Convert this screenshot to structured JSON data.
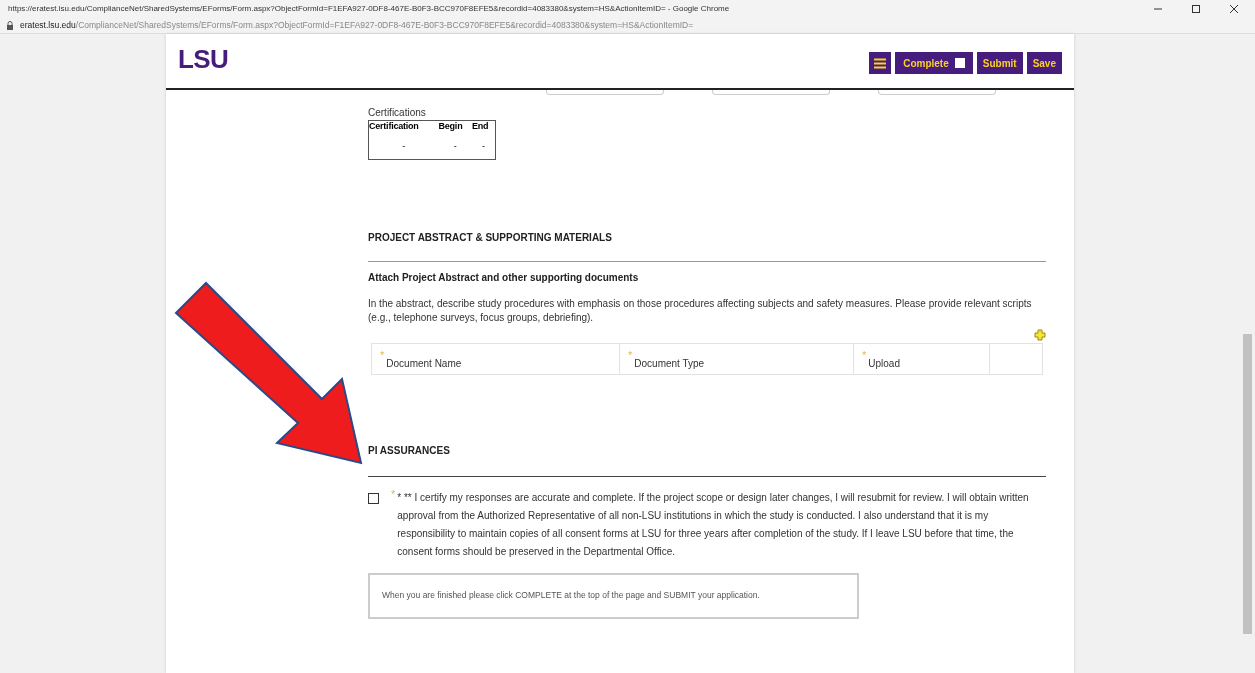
{
  "browser": {
    "title": "https://eratest.lsu.edu/ComplianceNet/SharedSystems/EForms/Form.aspx?ObjectFormId=F1EFA927-0DF8-467E-B0F3-BCC970F8EFE5&recordid=4083380&system=HS&ActionItemID= - Google Chrome",
    "url_domain": "eratest.lsu.edu",
    "url_path": "/ComplianceNet/SharedSystems/EForms/Form.aspx?ObjectFormId=F1EFA927-0DF8-467E-B0F3-BCC970F8EFE5&recordid=4083380&system=HS&ActionItemID="
  },
  "header": {
    "logo": "LSU",
    "complete": {
      "label": "Complete",
      "checked": false
    },
    "buttons": [
      "Submit",
      "Save"
    ]
  },
  "certifications": {
    "label": "Certifications",
    "columns": [
      "Certification",
      "Begin",
      "End"
    ],
    "row": [
      "-",
      "-",
      "-"
    ]
  },
  "abstract_section": {
    "heading": "PROJECT ABSTRACT & SUPPORTING MATERIALS",
    "subheading": "Attach Project Abstract and other supporting documents",
    "description": "In the abstract, describe study procedures with emphasis on those procedures affecting subjects and safety measures. Please provide relevant scripts (e.g., telephone surveys, focus groups, debriefing).",
    "columns": [
      {
        "label": "Document Name",
        "required_mark": "*"
      },
      {
        "label": "Document Type",
        "required_mark": "*"
      },
      {
        "label": "Upload",
        "required_mark": "*"
      }
    ]
  },
  "assurances": {
    "heading": "PI ASSURANCES",
    "checked": false,
    "required_mark": "*",
    "text": "* ** I certify my responses are accurate and complete. If the project scope or design later changes, I will resubmit for review. I will obtain written approval from the Authorized Representative of all non-LSU institutions in which the study is conducted. I also understand that it is my responsibility to maintain copies of all consent forms at LSU for three years after completion of the study. If I leave LSU before that time, the consent forms should be preserved in the Departmental Office.",
    "note": "When you are finished please click COMPLETE at the top of the page and SUBMIT your application."
  }
}
